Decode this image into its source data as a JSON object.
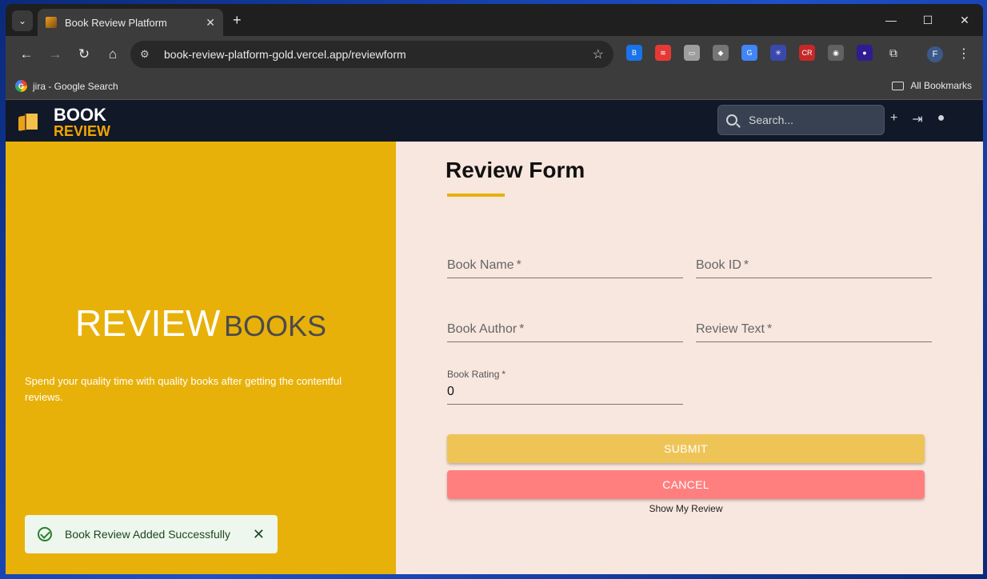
{
  "browser": {
    "tab_title": "Book Review Platform",
    "url": "book-review-platform-gold.vercel.app/reviewform",
    "bookmark": "jira - Google Search",
    "all_bookmarks": "All Bookmarks",
    "profile_initial": "F",
    "extensions": [
      {
        "name": "ext-blue",
        "label": "B",
        "color": "#1a73e8"
      },
      {
        "name": "ext-red",
        "label": "≋",
        "color": "#e53935"
      },
      {
        "name": "ext-window",
        "label": "▭",
        "color": "#9e9e9e"
      },
      {
        "name": "ext-eraser",
        "label": "◆",
        "color": "#757575"
      },
      {
        "name": "ext-translate",
        "label": "G",
        "color": "#4285f4"
      },
      {
        "name": "ext-star",
        "label": "✳",
        "color": "#3949ab"
      },
      {
        "name": "ext-cr",
        "label": "CR",
        "color": "#c62828"
      },
      {
        "name": "ext-globe",
        "label": "◉",
        "color": "#616161"
      },
      {
        "name": "ext-dark",
        "label": "●",
        "color": "#311b92"
      }
    ]
  },
  "app": {
    "logo_line1": "BOOK",
    "logo_line2": "REVIEW",
    "search_placeholder": "Search..."
  },
  "hero": {
    "word1": "REVIEW",
    "word2": "BOOKS",
    "tagline": "Spend your quality time with quality books after getting the contentful reviews."
  },
  "form": {
    "title": "Review Form",
    "book_name": "Book Name",
    "book_id": "Book ID",
    "book_author": "Book Author",
    "review_text": "Review Text",
    "book_rating_label": "Book Rating",
    "book_rating_value": "0",
    "required_mark": "*",
    "submit": "SUBMIT",
    "cancel": "CANCEL",
    "show_my_review": "Show My Review"
  },
  "toast": {
    "message": "Book Review Added Successfully"
  }
}
